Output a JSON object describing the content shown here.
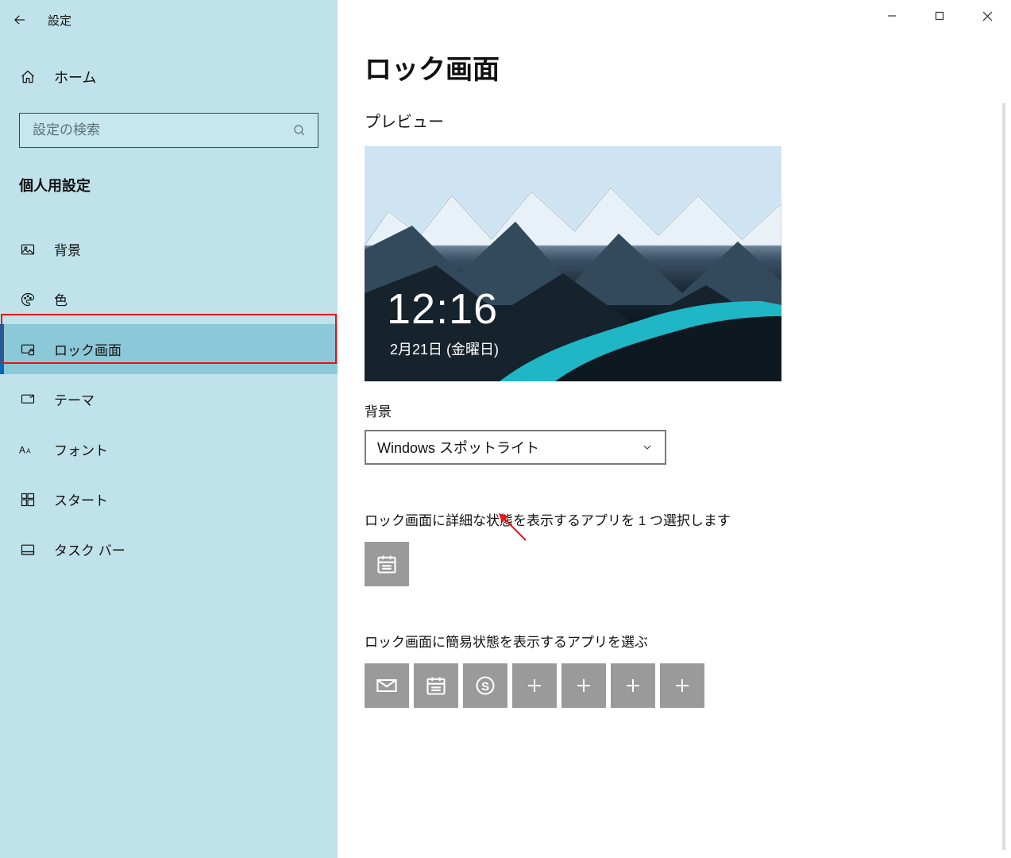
{
  "window": {
    "title": "設定",
    "controls": {
      "minimize": "minimize",
      "maximize": "maximize",
      "close": "close"
    }
  },
  "sidebar": {
    "home": "ホーム",
    "search_placeholder": "設定の検索",
    "category": "個人用設定",
    "items": [
      {
        "icon": "picture-icon",
        "label": "背景",
        "selected": false
      },
      {
        "icon": "palette-icon",
        "label": "色",
        "selected": false
      },
      {
        "icon": "lock-monitor-icon",
        "label": "ロック画面",
        "selected": true
      },
      {
        "icon": "theme-icon",
        "label": "テーマ",
        "selected": false
      },
      {
        "icon": "font-icon",
        "label": "フォント",
        "selected": false
      },
      {
        "icon": "start-icon",
        "label": "スタート",
        "selected": false
      },
      {
        "icon": "taskbar-icon",
        "label": "タスク バー",
        "selected": false
      }
    ]
  },
  "page": {
    "title": "ロック画面",
    "preview_label": "プレビュー",
    "preview_time": "12:16",
    "preview_date": "2月21日 (金曜日)",
    "background_label": "背景",
    "background_dropdown": "Windows スポットライト",
    "detailed_section": "ロック画面に詳細な状態を表示するアプリを 1 つ選択します",
    "detailed_app": "calendar-icon",
    "quick_section": "ロック画面に簡易状態を表示するアプリを選ぶ",
    "quick_apps": [
      "mail-icon",
      "calendar-icon",
      "skype-icon",
      "plus-icon",
      "plus-icon",
      "plus-icon",
      "plus-icon"
    ]
  }
}
